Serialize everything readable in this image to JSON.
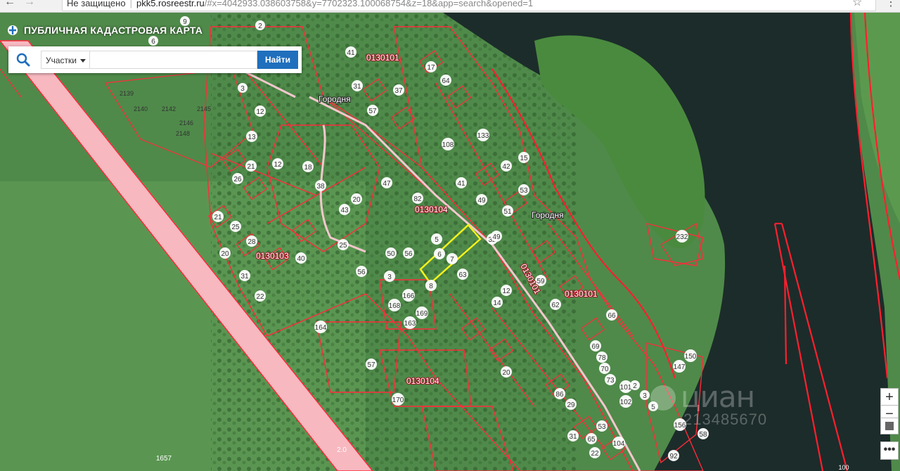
{
  "browser": {
    "security_label": "Не защищено",
    "url_host": "pkk5.rosreestr.ru",
    "url_path": "/#x=4042933.038603758&y=7702323.100068754&z=18&app=search&opened=1",
    "back_icon": "arrow-left-icon",
    "forward_icon": "arrow-right-icon",
    "bookmark_icon": "star-icon",
    "menu_icon": "kebab-menu-icon"
  },
  "app": {
    "title": "ПУБЛИЧНАЯ КАДАСТРОВАЯ КАРТА",
    "logo_icon": "cadastral-logo-icon"
  },
  "search": {
    "type_selected": "Участки",
    "input_value": "",
    "input_placeholder": "",
    "button_label": "Найти",
    "icon": "search-icon"
  },
  "controls": {
    "zoom_in": "+",
    "zoom_out": "−",
    "more": "•••"
  },
  "map": {
    "colors": {
      "boundary": "#ff2b3a",
      "highway": "#f7b8c0",
      "water": "#1c2c2a",
      "field": "#4f8a4a",
      "selected": "#f5f21a"
    },
    "place_labels": [
      "Городня",
      "Городня"
    ],
    "quarter_labels": [
      "0130101",
      "0130104",
      "0130103",
      "0130101",
      "0130104",
      "0130101"
    ],
    "parcel_numbers": [
      "2",
      "6",
      "9",
      "3",
      "12",
      "2139",
      "2140",
      "2142",
      "2145",
      "2146",
      "2148",
      "13",
      "26",
      "21",
      "12",
      "25",
      "28",
      "20",
      "21",
      "31",
      "22",
      "18",
      "38",
      "40",
      "20",
      "43",
      "47",
      "50",
      "56",
      "25",
      "31",
      "41",
      "57",
      "37",
      "82",
      "56",
      "63",
      "8",
      "6",
      "7",
      "5",
      "3",
      "108",
      "42",
      "53",
      "41",
      "32",
      "64",
      "133",
      "15",
      "49",
      "51",
      "49",
      "17",
      "166",
      "169",
      "163",
      "168",
      "164",
      "57",
      "170",
      "20",
      "12",
      "14",
      "59",
      "62",
      "69",
      "86",
      "66",
      "78",
      "70",
      "73",
      "101",
      "102",
      "2",
      "3",
      "5",
      "156",
      "147",
      "150",
      "232",
      "58",
      "92",
      "104",
      "29",
      "31",
      "65",
      "53",
      "22",
      "1657",
      "2.0",
      "100"
    ],
    "highway_label": "2.0",
    "scale_label": "100"
  },
  "watermark": {
    "brand": "циан",
    "number": "213485670"
  }
}
